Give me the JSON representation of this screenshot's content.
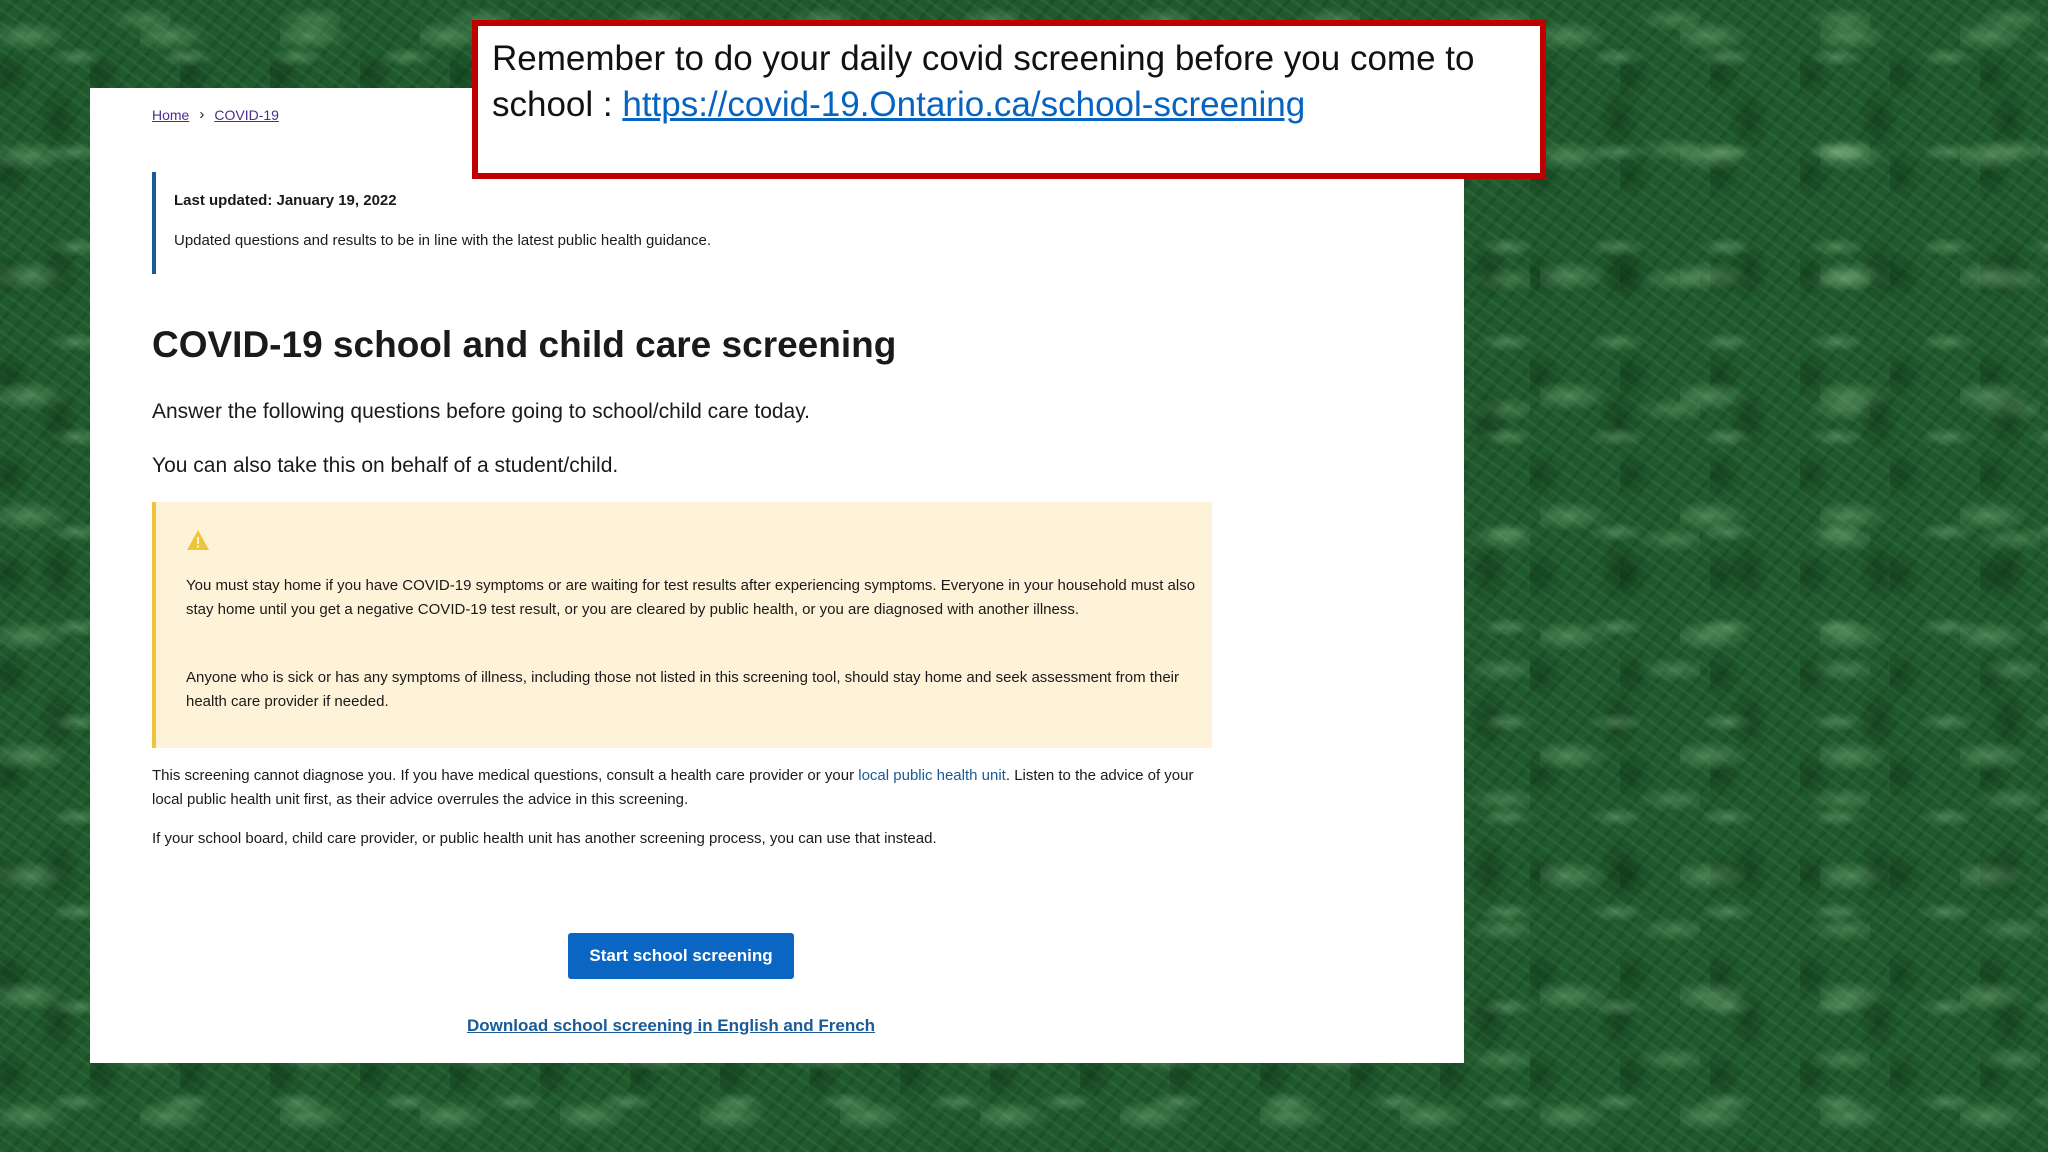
{
  "breadcrumb": {
    "home": "Home",
    "current": "COVID-19",
    "separator": "›"
  },
  "update": {
    "date": "Last updated: January 19, 2022",
    "note": "Updated questions and results to be in line with the latest public health guidance."
  },
  "main": {
    "title": "COVID-19 school and child care screening",
    "intro1": "Answer the following questions before going to school/child care today.",
    "intro2": "You can also take this on behalf of a student/child."
  },
  "alert": {
    "icon": "warning-triangle-icon",
    "p1": "You must stay home if you have COVID-19 symptoms or are waiting for test results after experiencing symptoms. Everyone in your household must also stay home until you get a negative COVID-19 test result, or you are cleared by public health, or you are diagnosed with another illness.",
    "p2": "Anyone who is sick or has any symptoms of illness, including those not listed in this screening tool, should stay home and seek assessment from their health care provider if needed."
  },
  "disclaimer": {
    "before": "This screening cannot diagnose you. If you have medical questions, consult a health care provider or your ",
    "link": "local public health unit",
    "after": ". Listen to the advice of your local public health unit first, as their advice overrules the advice in this screening."
  },
  "alt_process": "If your school board, child care provider, or public health unit has another screening process, you can use that instead.",
  "actions": {
    "start_label": "Start school screening",
    "download_label": "Download school screening in English and French"
  },
  "callout": {
    "text": "Remember to do your daily covid screening before you come to school : ",
    "link": "https://covid-19.Ontario.ca/school-screening"
  },
  "colors": {
    "accent_blue": "#0b66c3",
    "callout_border": "#c00000",
    "alert_background": "#fef3d9",
    "alert_border": "#f0c43a",
    "background_green": "#1f5a2c"
  }
}
